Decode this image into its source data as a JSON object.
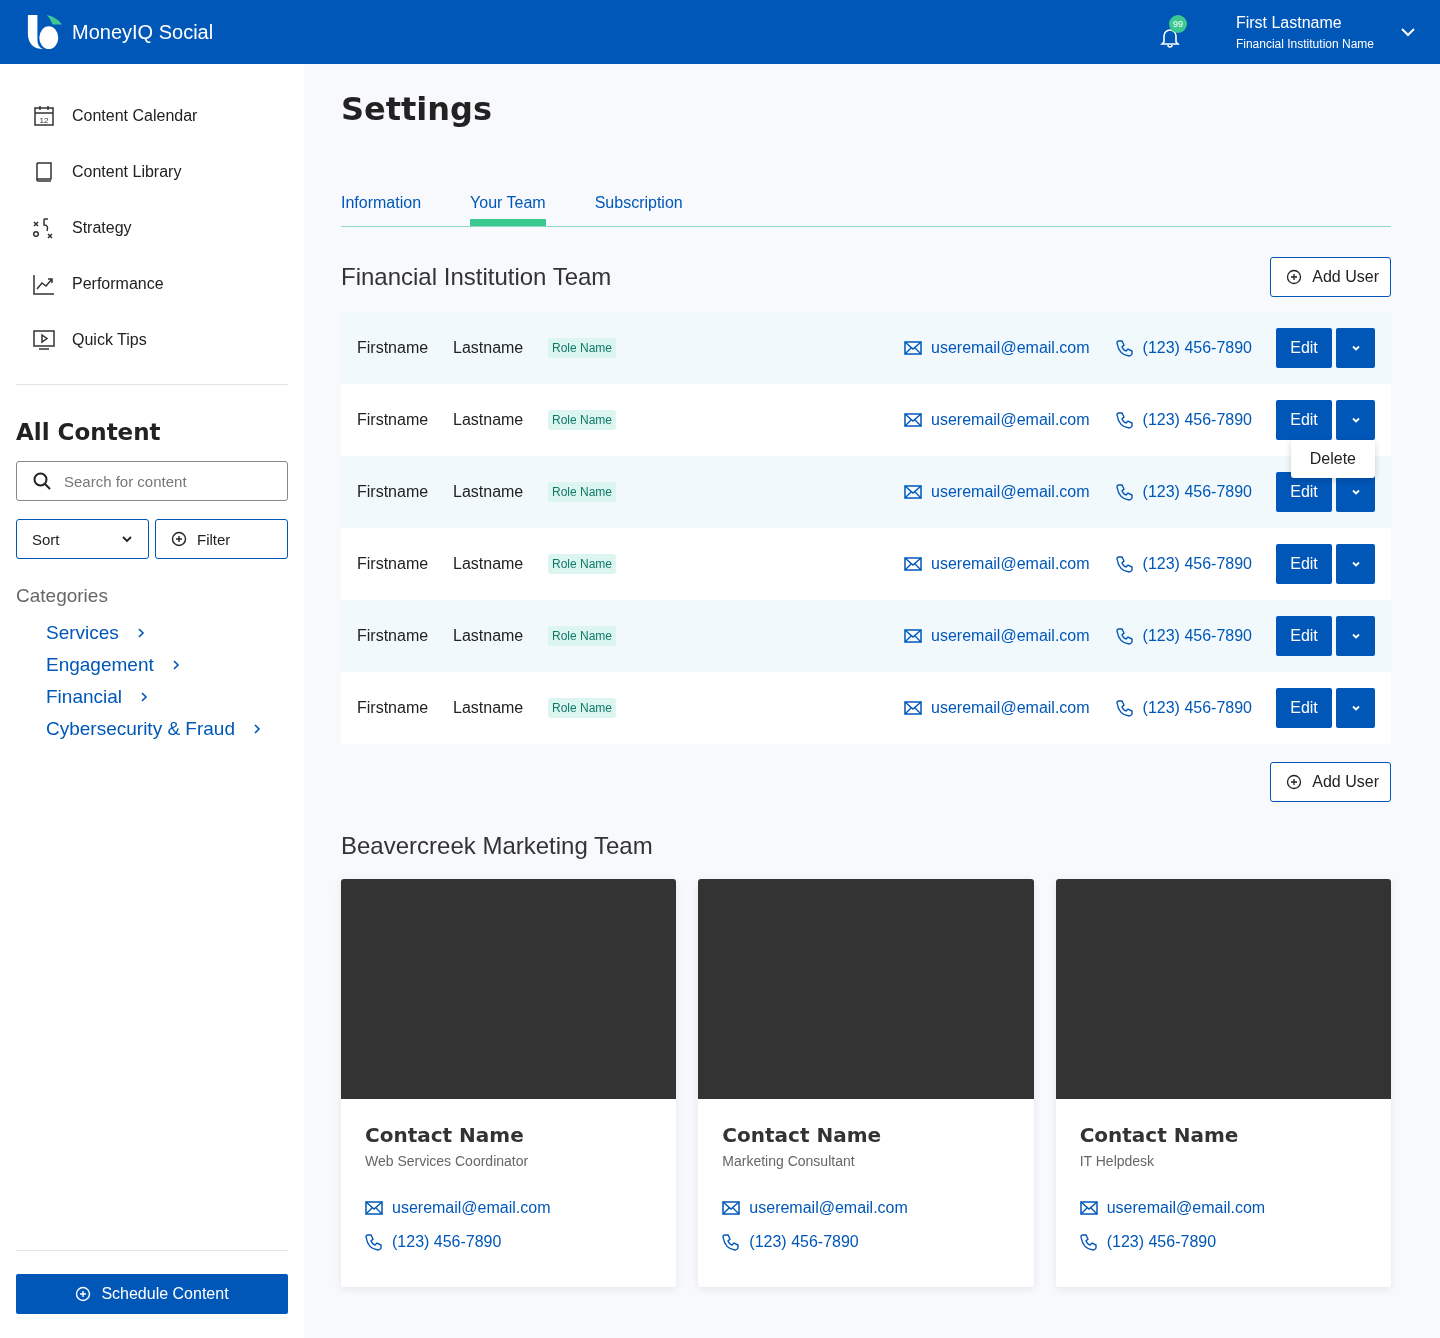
{
  "header": {
    "brand": "MoneyIQ Social",
    "notification_count": "99",
    "user_name": "First Lastname",
    "user_org": "Financial Institution Name"
  },
  "sidebar": {
    "nav": [
      {
        "kind": "calendar",
        "label": "Content Calendar",
        "calendar_day": "12"
      },
      {
        "kind": "book",
        "label": "Content Library"
      },
      {
        "kind": "strategy",
        "label": "Strategy"
      },
      {
        "kind": "chart",
        "label": "Performance"
      },
      {
        "kind": "video",
        "label": "Quick Tips"
      }
    ],
    "section_title": "All Content",
    "search": {
      "placeholder": "Search for content"
    },
    "sort_label": "Sort",
    "filter_label": "Filter",
    "categories_title": "Categories",
    "categories": [
      "Services",
      "Engagement",
      "Financial",
      "Cybersecurity & Fraud"
    ],
    "schedule_button": "Schedule Content"
  },
  "page_title": "Settings",
  "tabs": [
    {
      "label": "Information",
      "selected": false
    },
    {
      "label": "Your Team",
      "selected": true
    },
    {
      "label": "Subscription",
      "selected": false
    }
  ],
  "team": {
    "title": "Financial Institution Team",
    "add_user_top": "Add User",
    "add_user_bottom": "Add User",
    "row_menu": [
      "Delete"
    ],
    "members": [
      {
        "first": "Firstname",
        "last": "Lastname",
        "role": "Role Name",
        "email": "useremail@email.com",
        "phone": "(123) 456-7890",
        "edit": "Edit",
        "menu_open": false
      },
      {
        "first": "Firstname",
        "last": "Lastname",
        "role": "Role Name",
        "email": "useremail@email.com",
        "phone": "(123) 456-7890",
        "edit": "Edit",
        "menu_open": true
      },
      {
        "first": "Firstname",
        "last": "Lastname",
        "role": "Role Name",
        "email": "useremail@email.com",
        "phone": "(123) 456-7890",
        "edit": "Edit",
        "menu_open": false
      },
      {
        "first": "Firstname",
        "last": "Lastname",
        "role": "Role Name",
        "email": "useremail@email.com",
        "phone": "(123) 456-7890",
        "edit": "Edit",
        "menu_open": false
      },
      {
        "first": "Firstname",
        "last": "Lastname",
        "role": "Role Name",
        "email": "useremail@email.com",
        "phone": "(123) 456-7890",
        "edit": "Edit",
        "menu_open": false
      },
      {
        "first": "Firstname",
        "last": "Lastname",
        "role": "Role Name",
        "email": "useremail@email.com",
        "phone": "(123) 456-7890",
        "edit": "Edit",
        "menu_open": false
      }
    ]
  },
  "marketing": {
    "title": "Beavercreek Marketing Team",
    "cards": [
      {
        "name": "Contact Name",
        "position": "Web Services Coordinator",
        "email": "useremail@email.com",
        "phone": "(123) 456-7890"
      },
      {
        "name": "Contact Name",
        "position": "Marketing Consultant",
        "email": "useremail@email.com",
        "phone": "(123) 456-7890"
      },
      {
        "name": "Contact Name",
        "position": "IT Helpdesk",
        "email": "useremail@email.com",
        "phone": "(123) 456-7890"
      }
    ]
  }
}
